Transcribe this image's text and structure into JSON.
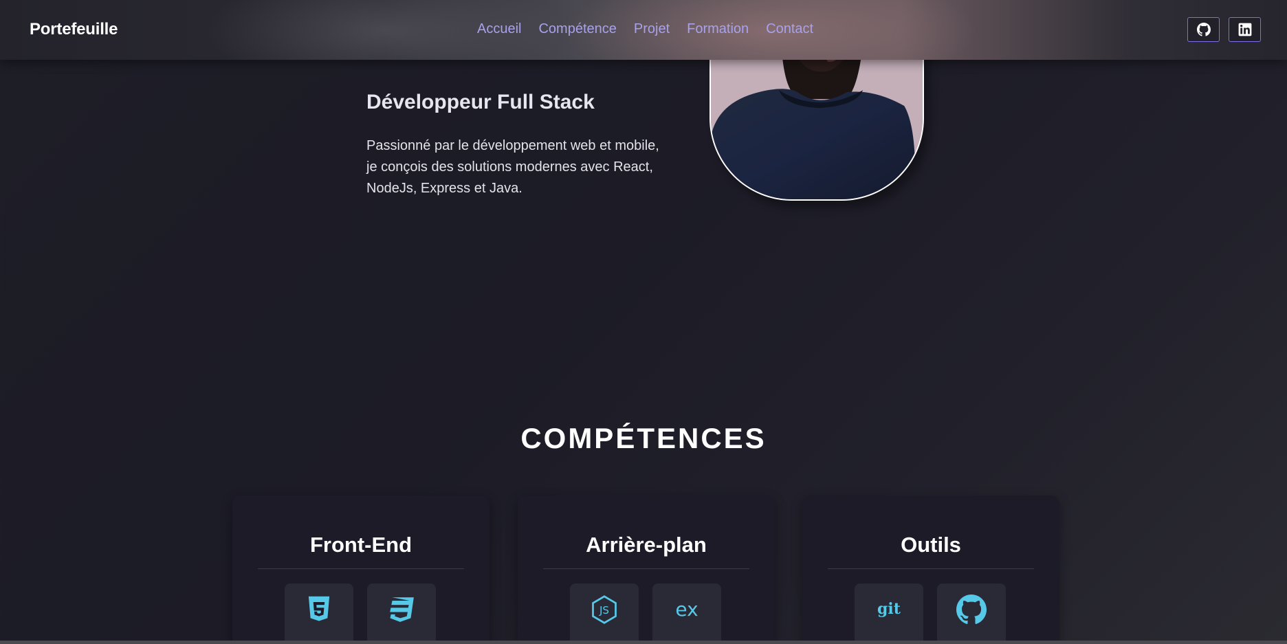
{
  "navbar": {
    "brand": "Portefeuille",
    "links": [
      "Accueil",
      "Compétence",
      "Projet",
      "Formation",
      "Contact"
    ],
    "social": [
      "github-icon",
      "linkedin-icon"
    ],
    "link_color": "#a8a2ec",
    "social_border_color": "#7a70e8"
  },
  "hero": {
    "title": "Développeur Full Stack",
    "description": "Passionné par le développement web et mobile, je conçois des solutions modernes avec React, NodeJs, Express et Java."
  },
  "skills": {
    "title": "COMPÉTENCES",
    "cards": [
      {
        "title": "Front-End",
        "icons": [
          "html5-icon",
          "css3-icon"
        ]
      },
      {
        "title": "Arrière-plan",
        "icons": [
          "nodejs-icon",
          "express-icon"
        ],
        "icon_labels": [
          "JS",
          "ex"
        ]
      },
      {
        "title": "Outils",
        "icons": [
          "git-icon",
          "github-icon"
        ],
        "icon_labels": [
          "git"
        ]
      }
    ],
    "icon_color": "#56c8e8"
  }
}
